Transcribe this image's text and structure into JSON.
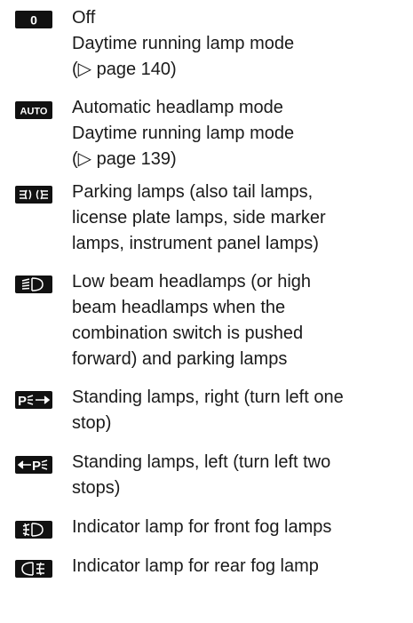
{
  "entries": [
    {
      "symbol": "0",
      "lines": [
        "Off",
        "Daytime running lamp mode",
        "(▷ page 140)"
      ]
    },
    {
      "symbol": "AUTO",
      "lines": [
        "Automatic headlamp mode",
        "Daytime running lamp mode",
        "(▷ page 139)"
      ]
    },
    {
      "symbol": "parking-lamps-icon",
      "lines": [
        "Parking lamps (also tail lamps,",
        "license plate lamps, side marker",
        "lamps, instrument panel lamps)"
      ]
    },
    {
      "symbol": "low-beam-icon",
      "lines": [
        "Low beam headlamps (or high",
        "beam headlamps when the",
        "combination switch is pushed",
        "forward) and parking lamps"
      ]
    },
    {
      "symbol": "standing-lamps-right-icon",
      "lines": [
        "Standing lamps, right (turn left one",
        "stop)"
      ]
    },
    {
      "symbol": "standing-lamps-left-icon",
      "lines": [
        "Standing lamps, left (turn left two",
        "stops)"
      ]
    },
    {
      "symbol": "front-fog-lamp-icon",
      "lines": [
        "Indicator lamp for front fog lamps"
      ]
    },
    {
      "symbol": "rear-fog-lamp-icon",
      "lines": [
        "Indicator lamp for rear fog lamp"
      ]
    }
  ]
}
